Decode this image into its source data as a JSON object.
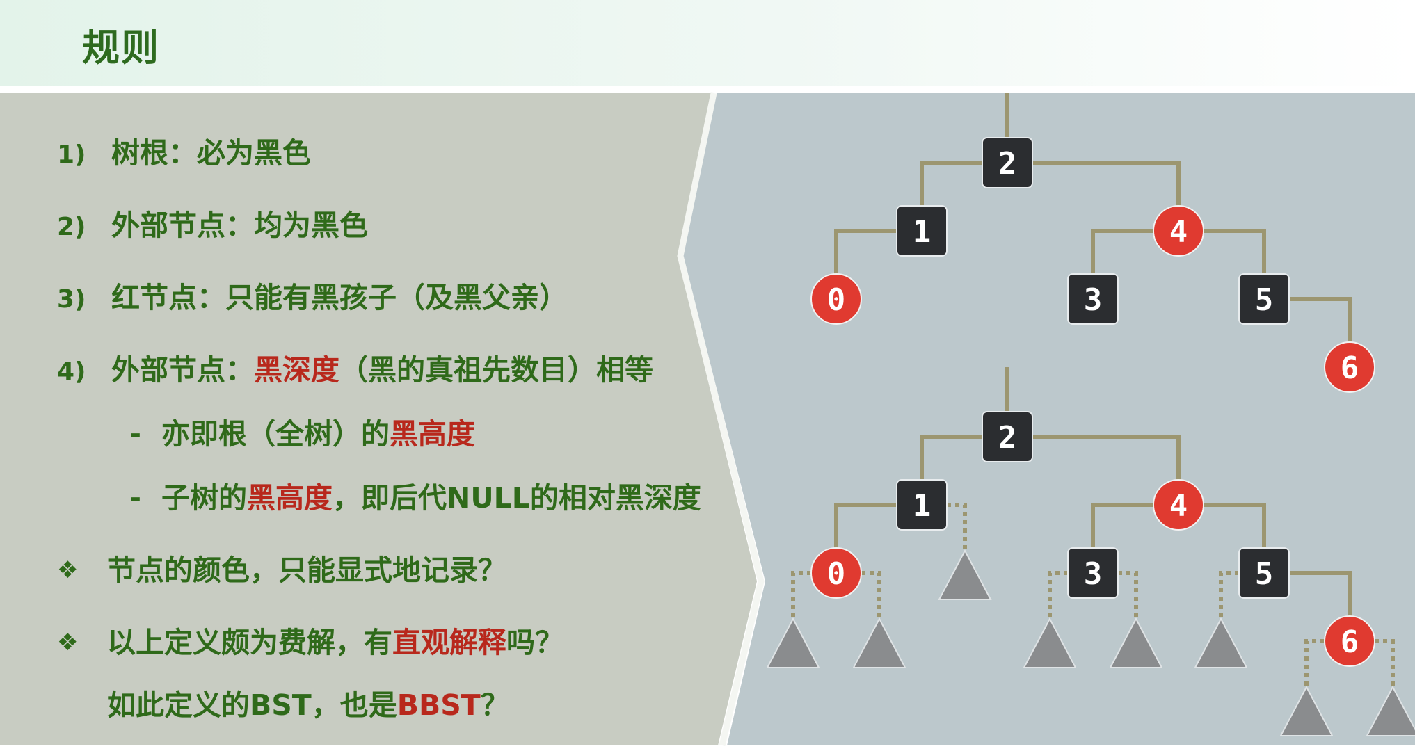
{
  "title": "规则",
  "rules": [
    {
      "prefix": "1)",
      "parts": [
        {
          "text": "树根：必为黑色",
          "hl": false
        }
      ]
    },
    {
      "prefix": "2)",
      "parts": [
        {
          "text": "外部节点：均为黑色",
          "hl": false
        }
      ]
    },
    {
      "prefix": "3)",
      "parts": [
        {
          "text": "红节点：只能有黑孩子（及黑父亲）",
          "hl": false
        }
      ]
    },
    {
      "prefix": "4)",
      "parts": [
        {
          "text": "外部节点：",
          "hl": false
        },
        {
          "text": "黑深度",
          "hl": true
        },
        {
          "text": "（黑的真祖先数目）相等",
          "hl": false
        }
      ]
    },
    {
      "prefix": "-",
      "sub": true,
      "parts": [
        {
          "text": "亦即根（全树）的",
          "hl": false
        },
        {
          "text": "黑高度",
          "hl": true
        }
      ]
    },
    {
      "prefix": "-",
      "sub": true,
      "parts": [
        {
          "text": "子树的",
          "hl": false
        },
        {
          "text": "黑高度",
          "hl": true
        },
        {
          "text": "，即后代NULL的相对黑深度",
          "hl": false
        }
      ]
    },
    {
      "prefix": "❖",
      "bullet": true,
      "parts": [
        {
          "text": "节点的颜色，只能显式地记录？",
          "hl": false
        }
      ]
    },
    {
      "prefix": "❖",
      "bullet": true,
      "parts": [
        {
          "text": "以上定义颇为费解，有",
          "hl": false
        },
        {
          "text": "直观解释",
          "hl": true
        },
        {
          "text": "吗？",
          "hl": false
        }
      ]
    },
    {
      "prefix": "",
      "bullet": true,
      "parts": [
        {
          "text": "如此定义的BST，也是",
          "hl": false
        },
        {
          "text": "BBST",
          "hl": true
        },
        {
          "text": "？",
          "hl": false
        }
      ]
    }
  ],
  "colors": {
    "black_node": "#2b2d30",
    "red_node": "#e03a30",
    "edge": "#9c9670",
    "external_node": "#8a8c8e",
    "text_green": "#2f6a1a",
    "highlight_red": "#b8281c",
    "left_panel": "#c8ccc2",
    "right_panel": "#bcc8cc"
  },
  "trees": [
    {
      "name": "tree-top",
      "nodes": [
        {
          "key": "2",
          "color": "black",
          "parent": null
        },
        {
          "key": "1",
          "color": "black",
          "parent": "2"
        },
        {
          "key": "4",
          "color": "red",
          "parent": "2"
        },
        {
          "key": "0",
          "color": "red",
          "parent": "1"
        },
        {
          "key": "3",
          "color": "black",
          "parent": "4"
        },
        {
          "key": "5",
          "color": "black",
          "parent": "4"
        },
        {
          "key": "6",
          "color": "red",
          "parent": "5"
        }
      ],
      "externals": false
    },
    {
      "name": "tree-bottom",
      "nodes": [
        {
          "key": "2",
          "color": "black",
          "parent": null
        },
        {
          "key": "1",
          "color": "black",
          "parent": "2"
        },
        {
          "key": "4",
          "color": "red",
          "parent": "2"
        },
        {
          "key": "0",
          "color": "red",
          "parent": "1"
        },
        {
          "key": "3",
          "color": "black",
          "parent": "4"
        },
        {
          "key": "5",
          "color": "black",
          "parent": "4"
        },
        {
          "key": "6",
          "color": "red",
          "parent": "5"
        }
      ],
      "externals": true
    }
  ]
}
